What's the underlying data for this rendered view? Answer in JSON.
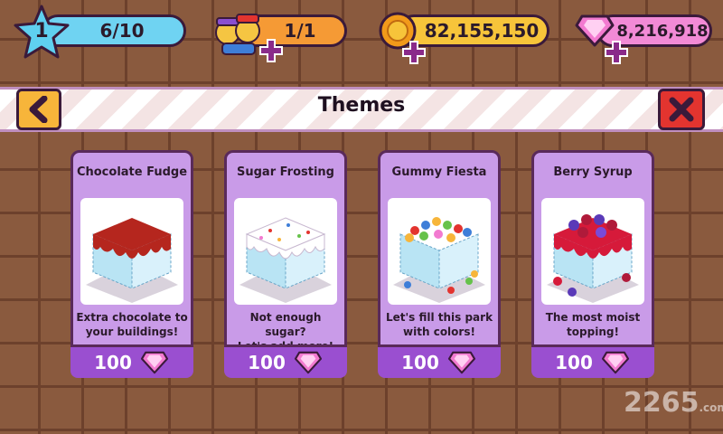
{
  "hud": {
    "level": "1",
    "progress": "6/10",
    "friends": "1/1",
    "coins": "82,155,150",
    "gems": "8,216,918"
  },
  "header": {
    "title": "Themes",
    "back_icon": "chevron-left-icon",
    "close_icon": "close-icon"
  },
  "themes": [
    {
      "name": "Chocolate Fudge",
      "desc1": "Extra chocolate to",
      "desc2": "your buildings!",
      "price": "100",
      "topping": "#b5261e"
    },
    {
      "name": "Sugar Frosting",
      "desc1": "Not enough sugar?",
      "desc2": "Let's add more!",
      "price": "100",
      "topping": "#ffffff"
    },
    {
      "name": "Gummy Fiesta",
      "desc1": "Let's fill this park",
      "desc2": "with colors!",
      "price": "100",
      "topping": "#66c24a"
    },
    {
      "name": "Berry Syrup",
      "desc1": "The most moist",
      "desc2": "topping!",
      "price": "100",
      "topping": "#d61a3a"
    }
  ],
  "watermark": {
    "main": "2265",
    "sub": ".com"
  },
  "colors": {
    "level_bar": "#6fd3f2",
    "friends_bar": "#f59a35",
    "coins_bar": "#f7c43a",
    "gems_bar": "#f28ad6",
    "card": "#c99be8",
    "price_bar": "#9a4fd0"
  }
}
